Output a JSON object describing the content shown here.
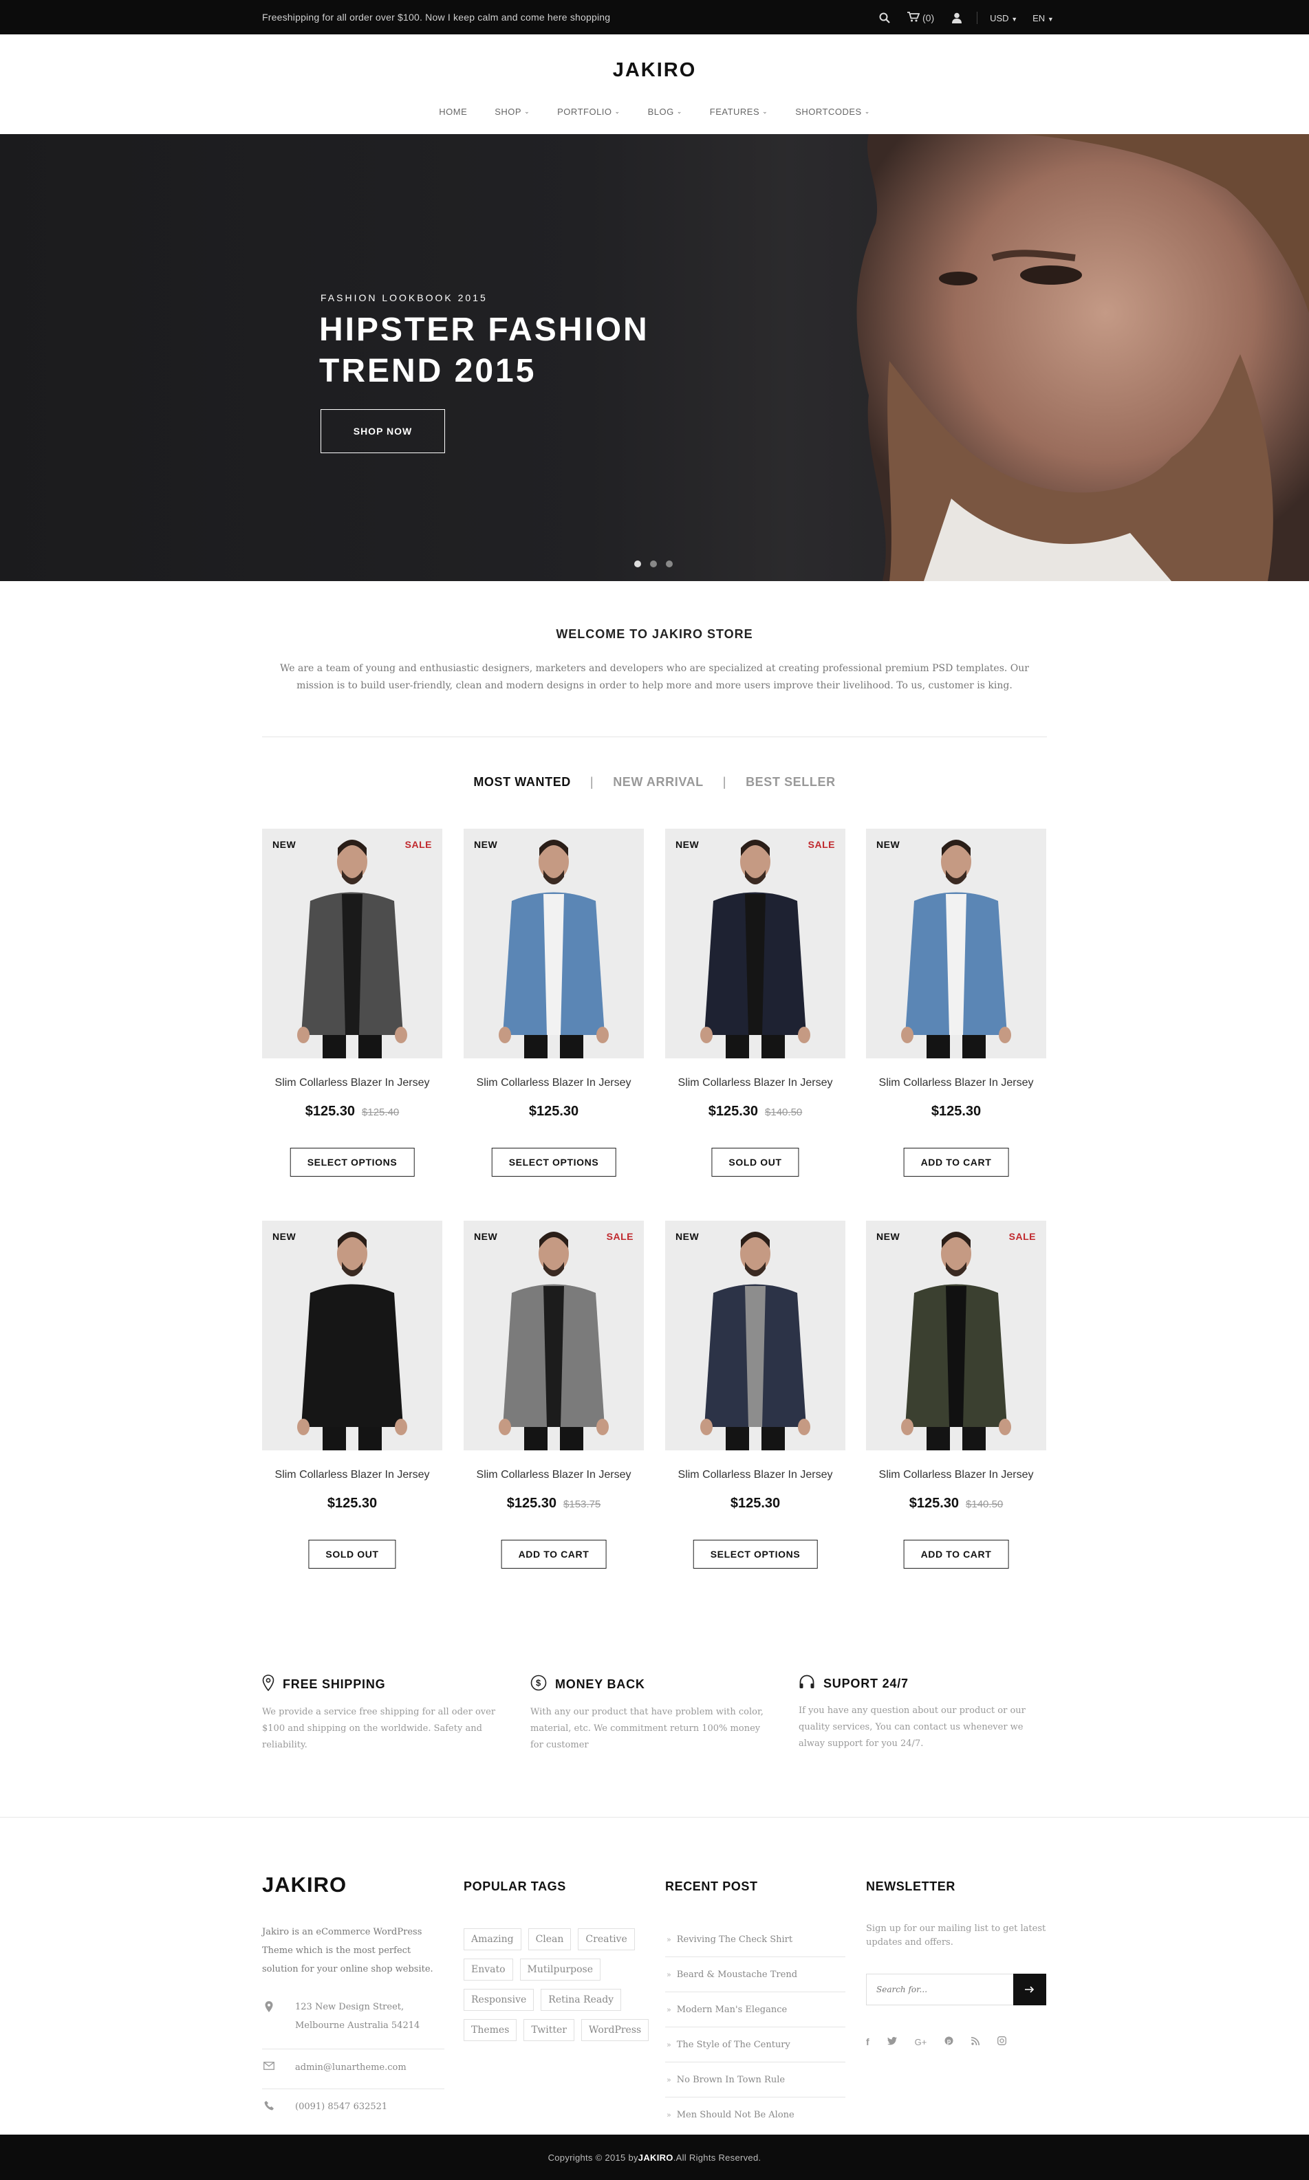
{
  "topbar": {
    "message": "Freeshipping for all order over $100. Now I keep calm and come here shopping",
    "cart_count": "(0)",
    "currency": "USD",
    "language": "EN"
  },
  "header": {
    "logo": "JAKIRO",
    "nav": [
      "HOME",
      "SHOP",
      "PORTFOLIO",
      "BLOG",
      "FEATURES",
      "SHORTCODES"
    ]
  },
  "hero": {
    "kicker": "FASHION LOOKBOOK 2015",
    "title_line1": "HIPSTER FASHION",
    "title_line2": "TREND 2015",
    "button": "SHOP NOW",
    "slide_count": 3,
    "active_slide": 1
  },
  "welcome": {
    "title": "WELCOME TO JAKIRO STORE",
    "text": "We are a team of young and enthusiastic designers, marketers and developers who are specialized at creating professional premium PSD templates. Our mission is to build user-friendly, clean and modern designs in order to help more and more users improve their livelihood. To us, customer is king."
  },
  "tabs": [
    "MOST WANTED",
    "NEW ARRIVAL",
    "BEST SELLER"
  ],
  "products": [
    {
      "badge_new": "NEW",
      "badge_sale": "SALE",
      "name": "Slim Collarless Blazer In Jersey",
      "price": "$125.30",
      "old_price": "$125.40",
      "action": "SELECT OPTIONS"
    },
    {
      "badge_new": "NEW",
      "badge_sale": "",
      "name": "Slim Collarless Blazer In Jersey",
      "price": "$125.30",
      "old_price": "",
      "action": "SELECT OPTIONS"
    },
    {
      "badge_new": "NEW",
      "badge_sale": "SALE",
      "name": "Slim Collarless Blazer In Jersey",
      "price": "$125.30",
      "old_price": "$140.50",
      "action": "SOLD OUT"
    },
    {
      "badge_new": "NEW",
      "badge_sale": "",
      "name": "Slim Collarless Blazer In Jersey",
      "price": "$125.30",
      "old_price": "",
      "action": "ADD TO CART"
    },
    {
      "badge_new": "NEW",
      "badge_sale": "",
      "name": "Slim Collarless Blazer In Jersey",
      "price": "$125.30",
      "old_price": "",
      "action": "SOLD OUT"
    },
    {
      "badge_new": "NEW",
      "badge_sale": "SALE",
      "name": "Slim Collarless Blazer In Jersey",
      "price": "$125.30",
      "old_price": "$153.75",
      "action": "ADD TO CART"
    },
    {
      "badge_new": "NEW",
      "badge_sale": "",
      "name": "Slim Collarless Blazer In Jersey",
      "price": "$125.30",
      "old_price": "",
      "action": "SELECT OPTIONS"
    },
    {
      "badge_new": "NEW",
      "badge_sale": "SALE",
      "name": "Slim Collarless Blazer In Jersey",
      "price": "$125.30",
      "old_price": "$140.50",
      "action": "ADD TO CART"
    }
  ],
  "features": [
    {
      "icon": "map-pin-icon",
      "title": "FREE SHIPPING",
      "text": "We provide a service free shipping for all oder over $100 and shipping on the worldwide. Safety and reliability."
    },
    {
      "icon": "dollar-coin-icon",
      "title": "MONEY BACK",
      "text": "With any our product that have problem with color, material, etc. We commitment return 100% money for customer"
    },
    {
      "icon": "headphones-icon",
      "title": "SUPORT 24/7",
      "text": "If you have any question about our product or our quality services, You can contact us whenever we alway support for you 24/7."
    }
  ],
  "footer": {
    "logo": "JAKIRO",
    "about": "Jakiro is an eCommerce WordPress Theme which is the most perfect solution for your online shop website.",
    "address": "123 New Design Street, Melbourne Australia 54214",
    "email": "admin@lunartheme.com",
    "phone": "(0091) 8547 632521",
    "tags_title": "POPULAR TAGS",
    "tags": [
      "Amazing",
      "Clean",
      "Creative",
      "Envato",
      "Mutilpurpose",
      "Responsive",
      "Retina Ready",
      "Themes",
      "Twitter",
      "WordPress"
    ],
    "posts_title": "RECENT POST",
    "posts": [
      "Reviving The Check Shirt",
      "Beard & Moustache Trend",
      "Modern Man's Elegance",
      "The Style of The Century",
      "No Brown In Town Rule",
      "Men Should Not Be Alone"
    ],
    "newsletter_title": "NEWSLETTER",
    "newsletter_text": "Sign up for our mailing list to get latest updates and offers.",
    "search_placeholder": "Search for...",
    "socials": [
      "facebook-icon",
      "twitter-icon",
      "google-plus-icon",
      "pinterest-icon",
      "rss-icon",
      "instagram-icon"
    ]
  },
  "bottom": {
    "prefix": "Copyrights © 2015 by ",
    "brand": "JAKIRO",
    "suffix": ".All Rights Reserved."
  }
}
